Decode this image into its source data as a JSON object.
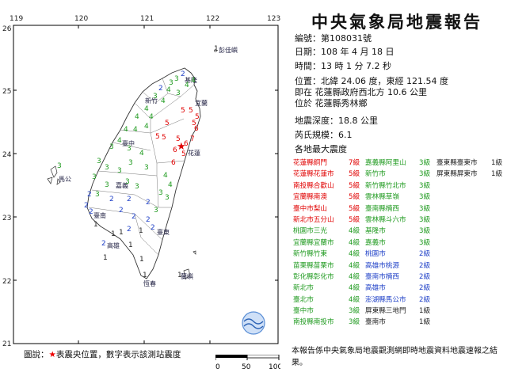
{
  "report": {
    "title": "中央氣象局地震報告",
    "number_label": "編號：",
    "number": "第108031號",
    "date_label": "日期：",
    "date": "108 年 4 月 18 日",
    "time_label": "時間：",
    "time": "13 時 1 分 7.2 秒",
    "position_label": "位置：",
    "position": "北緯 24.06 度，東經 121.54 度",
    "position_line2": "即在 花蓮縣政府西北方 10.6 公里",
    "position_line3": "位於 花蓮縣秀林鄉",
    "depth_label": "地震深度：",
    "depth": "18.8 公里",
    "magnitude_label": "芮氏規模：",
    "magnitude": "6.1",
    "intensity_header": "各地最大震度"
  },
  "intensity_table": [
    [
      "花蓮縣銅門",
      "7級",
      "嘉義縣阿里山",
      "3級",
      "臺東縣臺東市",
      "1級"
    ],
    [
      "花蓮縣花蓮市",
      "5級",
      "新竹市",
      "3級",
      "屏東縣屏東市",
      "1級"
    ],
    [
      "南投縣合歡山",
      "5級",
      "新竹縣竹北市",
      "3級",
      "",
      ""
    ],
    [
      "宜蘭縣南澳",
      "5級",
      "雲林縣草嶺",
      "3級",
      "",
      ""
    ],
    [
      "臺中市梨山",
      "5級",
      "臺南縣楠西",
      "3級",
      "",
      ""
    ],
    [
      "新北市五分山",
      "5級",
      "雲林縣斗六市",
      "3級",
      "",
      ""
    ],
    [
      "桃園市三光",
      "4級",
      "基隆市",
      "3級",
      "",
      ""
    ],
    [
      "宜蘭縣宜蘭市",
      "4級",
      "嘉義市",
      "3級",
      "",
      ""
    ],
    [
      "新竹縣竹東",
      "4級",
      "桃園市",
      "2級",
      "",
      ""
    ],
    [
      "苗栗縣苗栗市",
      "4級",
      "高雄市桃源",
      "2級",
      "",
      ""
    ],
    [
      "彰化縣彰化市",
      "4級",
      "臺南市楠西",
      "2級",
      "",
      ""
    ],
    [
      "新北市",
      "4級",
      "高雄市",
      "2級",
      "",
      ""
    ],
    [
      "臺北市",
      "4級",
      "澎湖縣馬公市",
      "2級",
      "",
      ""
    ],
    [
      "臺中市",
      "3級",
      "屏東縣三地門",
      "1級",
      "",
      ""
    ],
    [
      "南投縣南投市",
      "3級",
      "臺南市",
      "1級",
      "",
      ""
    ]
  ],
  "note": "本報告係中央氣象局地震觀測網即時地震資料地震速報之結果。",
  "legend": {
    "prefix": "圖說：",
    "star": "★",
    "text": "表震央位置，數字表示該測站震度"
  },
  "scale": {
    "ticks": [
      "0",
      "50",
      "100"
    ]
  },
  "map": {
    "lon_ticks": [
      "119",
      "120",
      "121",
      "122",
      "123"
    ],
    "lat_ticks": [
      "26",
      "25",
      "24",
      "23",
      "22",
      "21"
    ],
    "places": {
      "pengjia": "彭佳嶼",
      "keelung": "基隆",
      "yilan": "宜蘭",
      "hsinchu": "新竹",
      "hualien": "花蓮",
      "taichung": "臺中",
      "magong": "馬公",
      "chiayi": "嘉義",
      "tainan": "臺南",
      "kaohsiung": "高雄",
      "taitung": "臺東",
      "hengchun": "恆春",
      "lanyu": "蘭嶼"
    },
    "epicenter_marker": "★",
    "colors": {
      "i7": "#e00000",
      "i5": "#e00000",
      "i4": "#1f9a1f",
      "i3": "#1f9a1f",
      "i2": "#2243c8",
      "i1": "#222222"
    }
  },
  "intensity_colors": {
    "7級": "#e00000",
    "5級": "#e00000",
    "4級": "#1f9a1f",
    "3級": "#1f9a1f",
    "2級": "#2243c8",
    "1級": "#222222"
  }
}
